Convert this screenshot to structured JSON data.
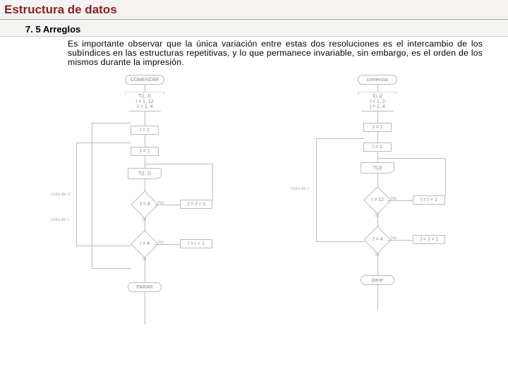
{
  "title": "Estructura de datos",
  "subtitle": "7. 5 Arreglos",
  "paragraph": "Es importante observar que la única variación entre estas dos resoluciones es el intercambio de los subíndices en las estructuras repetitivas, y lo que permanece invariable, sin embargo, es el orden de los mismos durante la impresión.",
  "flow_left": {
    "start": "COMENZAR",
    "read": "T(i, J)\nI = 1, 12\nJ = 1, 4",
    "s1": "I = 1",
    "s2": "J = 1",
    "out": "T(I, J)",
    "d1": "J = 4",
    "d1_no": "No",
    "inc1": "J = J + 1",
    "d1_yes": "Sí",
    "d2": "I = 4",
    "d2_no": "No",
    "inc2": "I = I + 1",
    "d2_yes": "Sí",
    "stop": "PARAR",
    "loop1": "ciclo de J",
    "loop2": "ciclo de I"
  },
  "flow_right": {
    "start": "comenzar",
    "read": "t(i, j)\ni = 1, 2\nj = 1, 4",
    "s1": "J = 1",
    "s2": "I = 1",
    "out": "T(J)",
    "d1": "I = 12",
    "d1_no": "No",
    "inc1": "I = I + 1",
    "d1_yes": "Sí",
    "d2": "J = 4",
    "d2_no": "No",
    "inc2": "J = J + 1",
    "d2_yes": "Sí",
    "stop": "parar",
    "loop1": "ciclo de I"
  }
}
